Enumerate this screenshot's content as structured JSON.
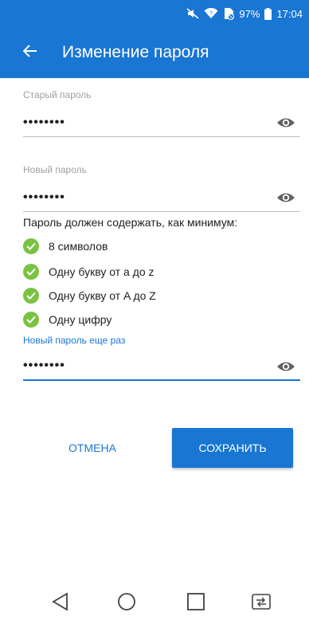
{
  "status_bar": {
    "battery_percent": "97%",
    "time": "17:04",
    "icons": [
      "mute-icon",
      "wifi-icon",
      "no-sim-icon",
      "battery-icon"
    ]
  },
  "app_bar": {
    "title": "Изменение пароля",
    "back_icon": "arrow-left-icon"
  },
  "form": {
    "old_password": {
      "label": "Старый пароль",
      "value": "••••••••"
    },
    "new_password": {
      "label": "Новый пароль",
      "value": "••••••••"
    },
    "confirm_password": {
      "label": "Новый пароль еще раз",
      "value": "••••••••"
    }
  },
  "requirements": {
    "title": "Пароль должен содержать, как минимум:",
    "items": [
      {
        "label": "8 символов",
        "met": true
      },
      {
        "label": "Одну букву от a до z",
        "met": true
      },
      {
        "label": "Одну букву от A до Z",
        "met": true
      },
      {
        "label": "Одну цифру",
        "met": true
      }
    ]
  },
  "actions": {
    "cancel_label": "ОТМЕНА",
    "save_label": "СОХРАНИТЬ"
  },
  "colors": {
    "primary": "#1976d2",
    "check_green": "#7cc242"
  }
}
